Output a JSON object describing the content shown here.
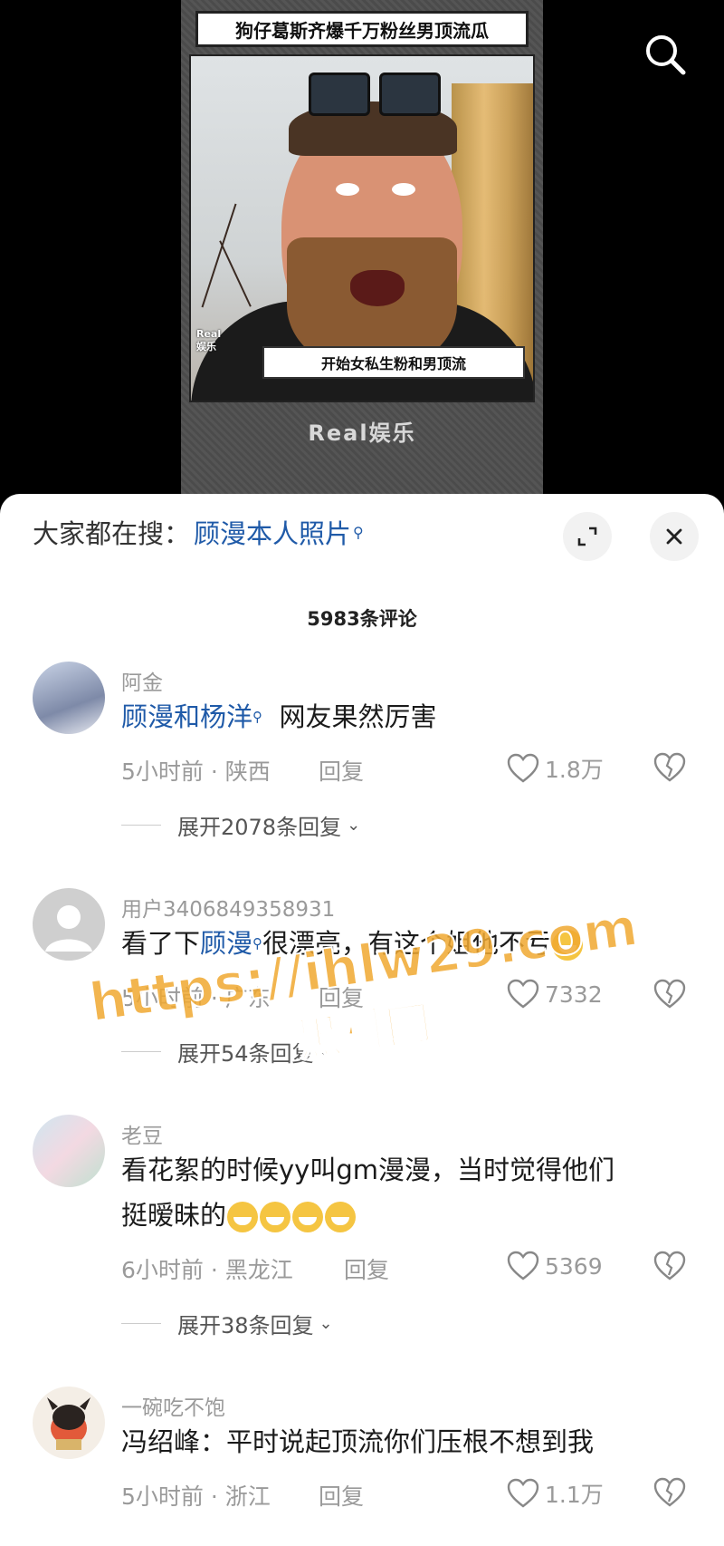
{
  "video": {
    "title": "狗仔葛斯齐爆千万粉丝男顶流瓜",
    "subtitle": "开始女私生粉和男顶流",
    "brand": "Real娱乐",
    "corner_logo": "Real\n娱乐"
  },
  "sheet": {
    "trending_prefix": "大家都在搜：",
    "trending_keyword": "顾漫本人照片",
    "comment_count_title": "5983条评论"
  },
  "comments": [
    {
      "username": "阿金",
      "text_keyword": "顾漫和杨洋",
      "text_rest": "  网友果然厉害",
      "meta": "5小时前 · 陕西",
      "reply": "回复",
      "likes": "1.8万",
      "expand": "展开2078条回复"
    },
    {
      "username": "用户3406849358931",
      "text_prefix": "看了下",
      "text_keyword": "顾漫",
      "text_rest": "很漂亮，有这个姐他不亏",
      "meta": "5小时前 · 广东",
      "reply": "回复",
      "likes": "7332",
      "expand": "展开54条回复"
    },
    {
      "username": "老豆",
      "text_line1": "看花絮的时候yy叫gm漫漫，当时觉得他们",
      "text_line2": "挺暧昧的",
      "meta": "6小时前 · 黑龙江",
      "reply": "回复",
      "likes": "5369",
      "expand": "展开38条回复"
    },
    {
      "username": "一碗吃不饱",
      "text": "冯绍峰：平时说起顶流你们压根不想到我",
      "meta": "5小时前 · 浙江",
      "reply": "回复",
      "likes": "1.1万"
    }
  ],
  "watermark": {
    "url": "https://ihlw29.com",
    "name": "黑料网"
  },
  "colors": {
    "keyword": "#1f5aa8",
    "muted": "#9a9a9a",
    "watermark": "#f0a830"
  }
}
